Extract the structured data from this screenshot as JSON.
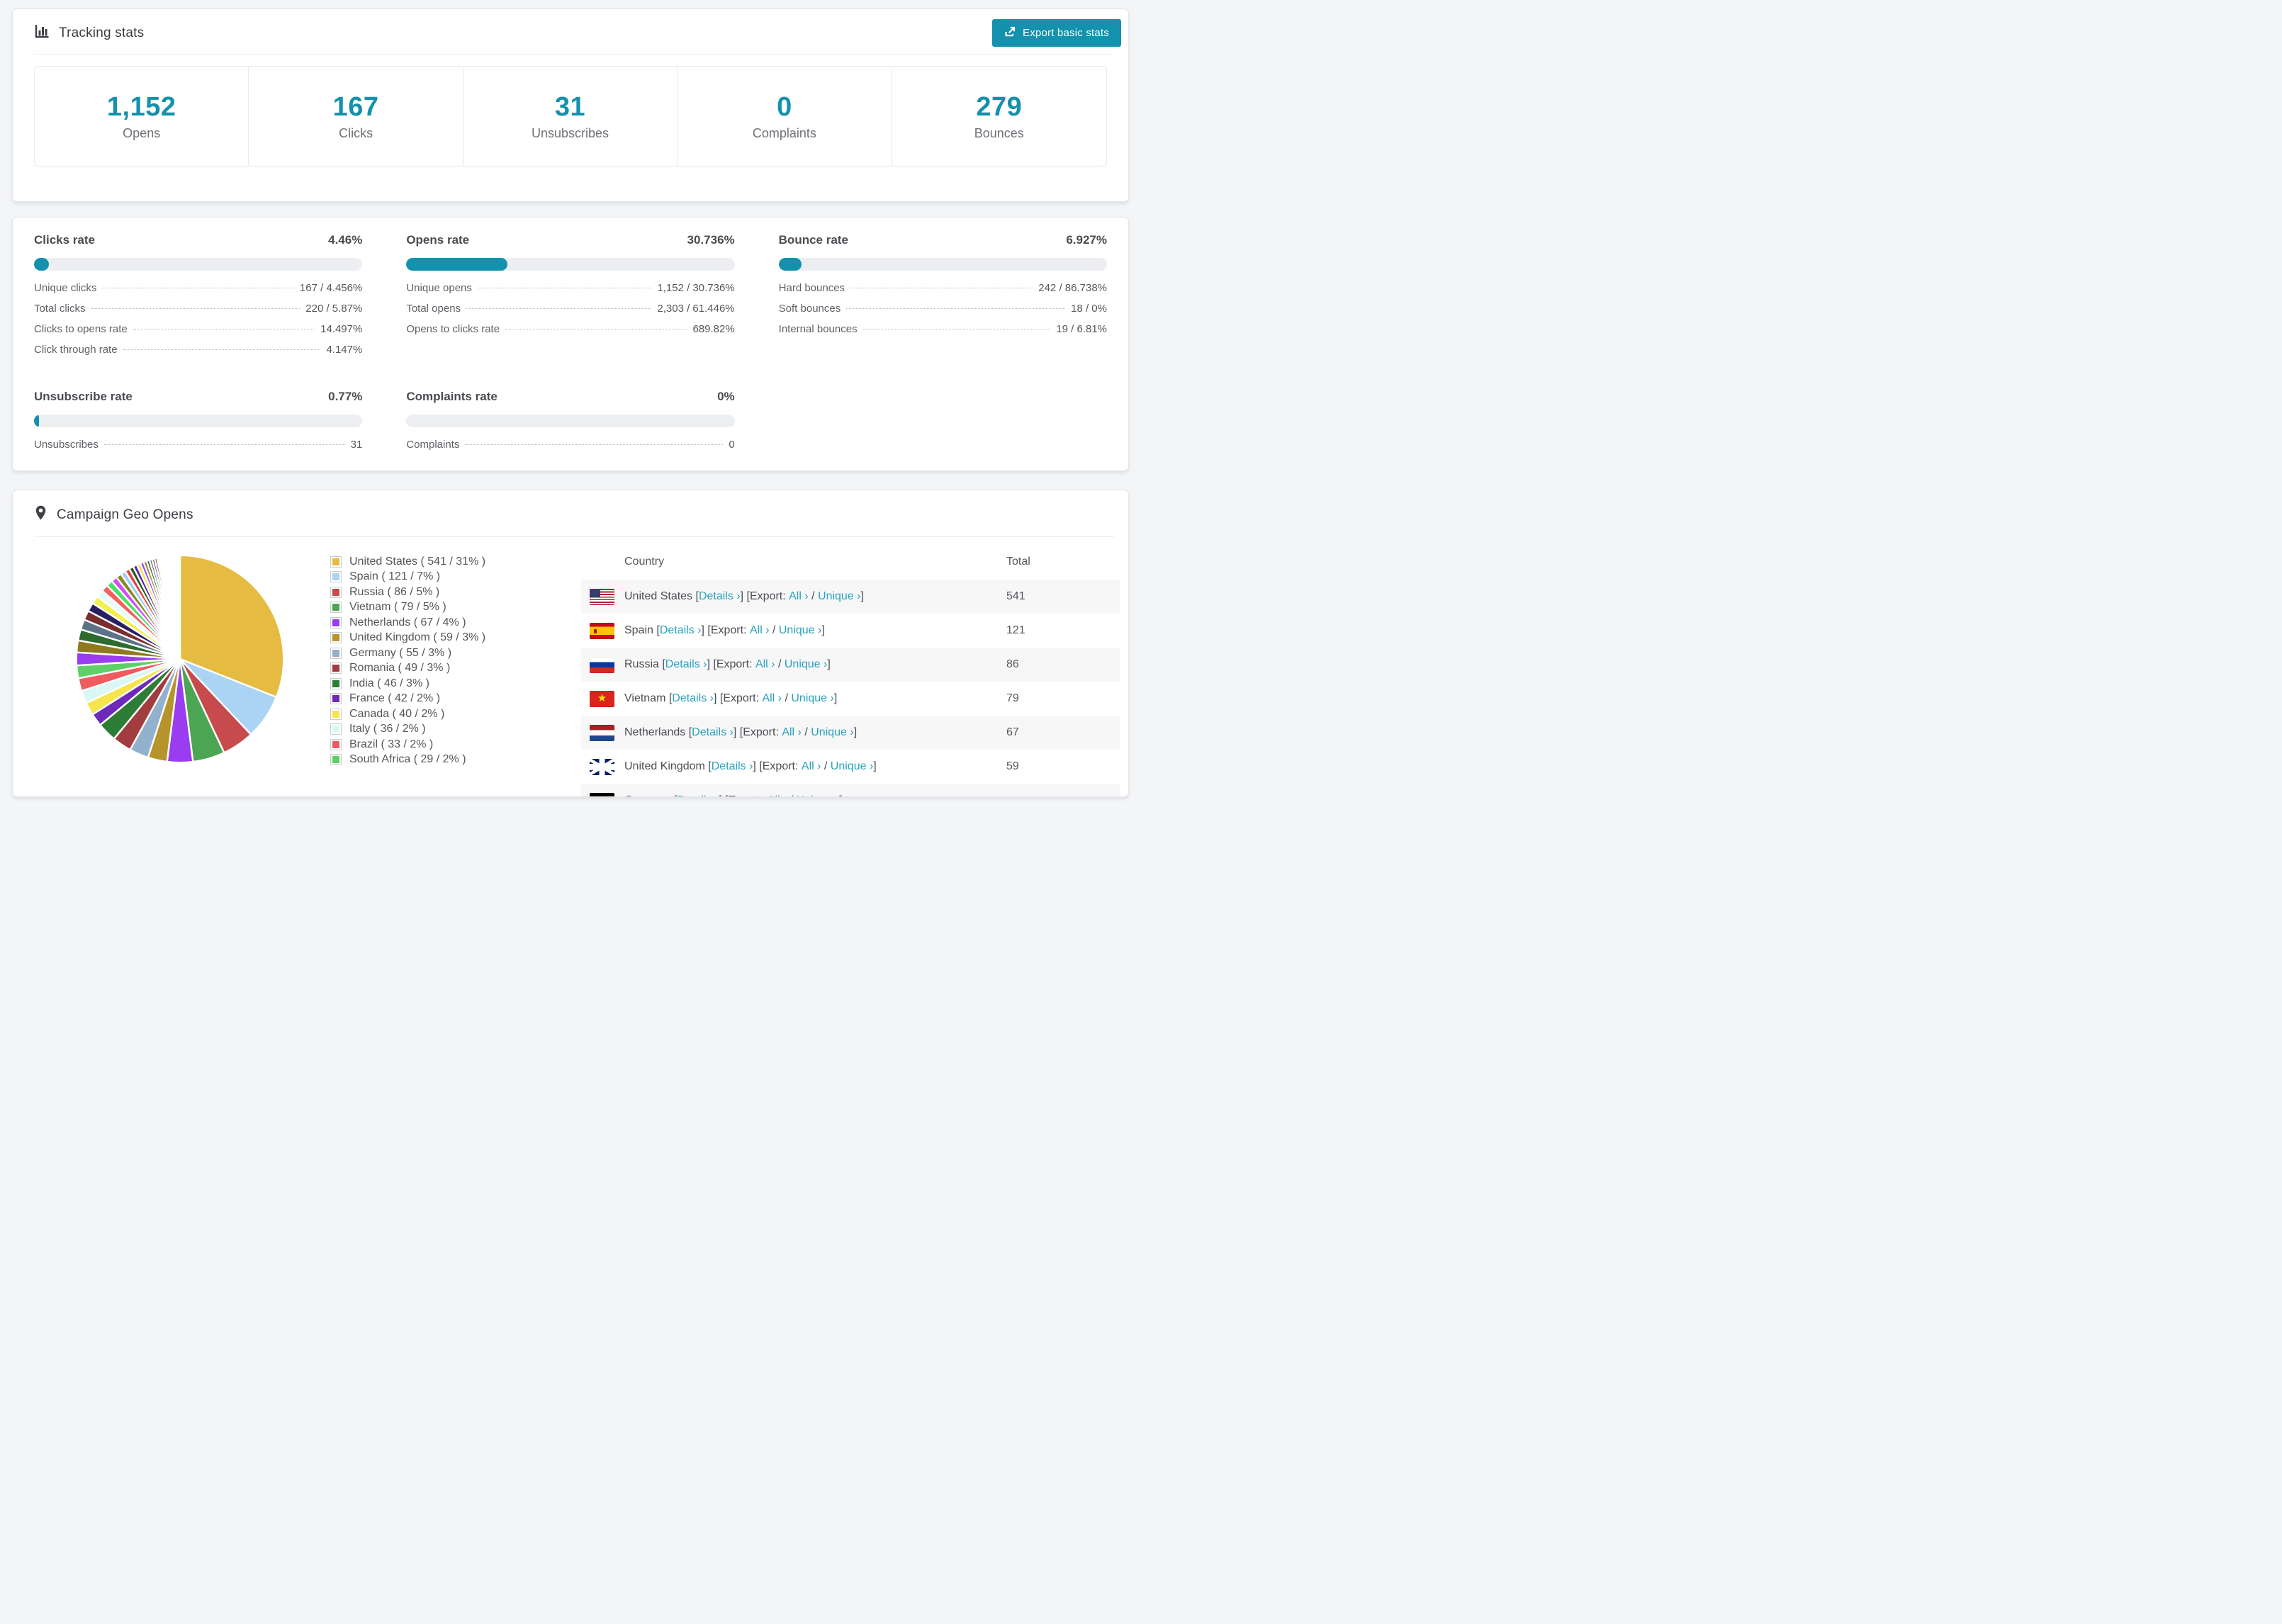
{
  "accent": "#1391ad",
  "link_color": "#2aa2be",
  "track_color": "#eceef1",
  "header": {
    "title": "Tracking stats",
    "export_label": "Export basic stats"
  },
  "summary": [
    {
      "value": "1,152",
      "label": "Opens"
    },
    {
      "value": "167",
      "label": "Clicks"
    },
    {
      "value": "31",
      "label": "Unsubscribes"
    },
    {
      "value": "0",
      "label": "Complaints"
    },
    {
      "value": "279",
      "label": "Bounces"
    }
  ],
  "rates": [
    {
      "title": "Clicks rate",
      "value": "4.46%",
      "percent": 4.46,
      "rows": [
        {
          "label": "Unique clicks",
          "value": "167 / 4.456%"
        },
        {
          "label": "Total clicks",
          "value": "220 / 5.87%"
        },
        {
          "label": "Clicks to opens rate",
          "value": "14.497%"
        },
        {
          "label": "Click through rate",
          "value": "4.147%"
        }
      ]
    },
    {
      "title": "Opens rate",
      "value": "30.736%",
      "percent": 30.736,
      "rows": [
        {
          "label": "Unique opens",
          "value": "1,152 / 30.736%"
        },
        {
          "label": "Total opens",
          "value": "2,303 / 61.446%"
        },
        {
          "label": "Opens to clicks rate",
          "value": "689.82%"
        }
      ]
    },
    {
      "title": "Bounce rate",
      "value": "6.927%",
      "percent": 6.927,
      "rows": [
        {
          "label": "Hard bounces",
          "value": "242 / 86.738%"
        },
        {
          "label": "Soft bounces",
          "value": "18 / 0%"
        },
        {
          "label": "Internal bounces",
          "value": "19 / 6.81%"
        }
      ]
    },
    {
      "title": "Unsubscribe rate",
      "value": "0.77%",
      "percent": 0.77,
      "rows": [
        {
          "label": "Unsubscribes",
          "value": "31"
        }
      ]
    },
    {
      "title": "Complaints rate",
      "value": "0%",
      "percent": 0,
      "rows": [
        {
          "label": "Complaints",
          "value": "0"
        }
      ]
    }
  ],
  "geo": {
    "title": "Campaign Geo Opens",
    "legend_label_format": "{name} ( {count} / {pct}% )",
    "table": {
      "headers": [
        "Country",
        "Total"
      ],
      "links": {
        "details": "Details ›",
        "export_prefix": "Export: ",
        "all": "All ›",
        "unique": "Unique ›"
      },
      "rows": [
        {
          "country": "United States",
          "total": "541",
          "flag": "us"
        },
        {
          "country": "Spain",
          "total": "121",
          "flag": "es"
        },
        {
          "country": "Russia",
          "total": "86",
          "flag": "ru"
        },
        {
          "country": "Vietnam",
          "total": "79",
          "flag": "vn"
        },
        {
          "country": "Netherlands",
          "total": "67",
          "flag": "nl"
        },
        {
          "country": "United Kingdom",
          "total": "59",
          "flag": "gb"
        }
      ],
      "partial_row": {
        "country": "Germany",
        "flag": "de"
      }
    }
  },
  "chart_data": {
    "type": "pie",
    "title": "Campaign Geo Opens",
    "unit": "opens",
    "legend_position": "right",
    "start_angle_deg": -90,
    "direction": "clockwise",
    "slices": [
      {
        "name": "United States",
        "count": 541,
        "pct": 31,
        "color": "#e5bb41"
      },
      {
        "name": "Spain",
        "count": 121,
        "pct": 7,
        "color": "#abd3f3"
      },
      {
        "name": "Russia",
        "count": 86,
        "pct": 5,
        "color": "#c74a4d"
      },
      {
        "name": "Vietnam",
        "count": 79,
        "pct": 5,
        "color": "#4ba553"
      },
      {
        "name": "Netherlands",
        "count": 67,
        "pct": 4,
        "color": "#9a3df0"
      },
      {
        "name": "United Kingdom",
        "count": 59,
        "pct": 3,
        "color": "#b7932b"
      },
      {
        "name": "Germany",
        "count": 55,
        "pct": 3,
        "color": "#91b1cc"
      },
      {
        "name": "Romania",
        "count": 49,
        "pct": 3,
        "color": "#a13c3f"
      },
      {
        "name": "India",
        "count": 46,
        "pct": 3,
        "color": "#2e7d36"
      },
      {
        "name": "France",
        "count": 42,
        "pct": 2,
        "color": "#6d2ab8"
      },
      {
        "name": "Canada",
        "count": 40,
        "pct": 2,
        "color": "#f6e44c"
      },
      {
        "name": "Italy",
        "count": 36,
        "pct": 2,
        "color": "#d9f7f4"
      },
      {
        "name": "Brazil",
        "count": 33,
        "pct": 2,
        "color": "#ef5b5e"
      },
      {
        "name": "South Africa",
        "count": 29,
        "pct": 2,
        "color": "#5ed065"
      }
    ],
    "unlabeled_tail": {
      "slice_count": 44,
      "total_pct": 26
    }
  }
}
